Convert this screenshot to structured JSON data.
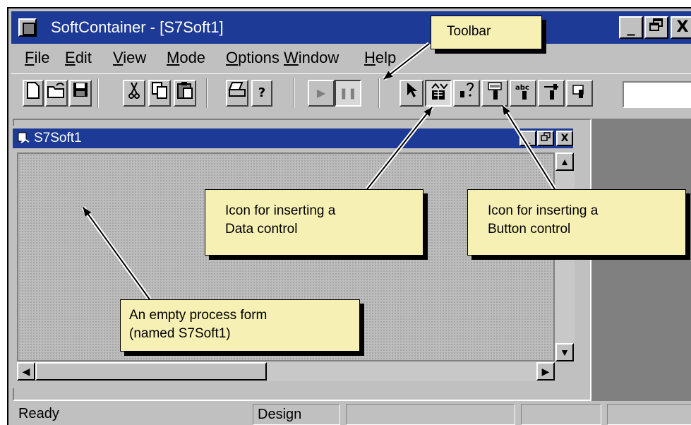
{
  "window": {
    "title": "SoftContainer - [S7Soft1]",
    "buttons": {
      "minimize": "_",
      "restore": "🗗",
      "close": "X"
    }
  },
  "menu": [
    "File",
    "Edit",
    "View",
    "Mode",
    "Options",
    "Window",
    "Help"
  ],
  "toolbar": {
    "icons": [
      "new-file-icon",
      "open-folder-icon",
      "save-disk-icon",
      "cut-icon",
      "copy-icon",
      "paste-icon",
      "print-icon",
      "help-icon",
      "run-icon",
      "pause-icon",
      "pointer-icon",
      "data-control-icon",
      "toggle-control-icon",
      "button-control-icon",
      "text-control-icon",
      "slider-control-icon",
      "misc-control-icon"
    ],
    "help_glyph": "?"
  },
  "child_window": {
    "title": "S7Soft1",
    "buttons": {
      "minimize": "_",
      "restore": "🗗",
      "close": "X"
    }
  },
  "status": {
    "left": "Ready",
    "mode": "Design"
  },
  "callouts": {
    "toolbar": "Toolbar",
    "data_control": [
      "Icon for inserting a",
      "Data control"
    ],
    "button_control": [
      "Icon for inserting a",
      "Button control"
    ],
    "process_form": [
      "An empty process form",
      "(named S7Soft1)"
    ]
  },
  "colors": {
    "titlebar": "#1c3a96",
    "callout_fill": "#f7f0b4",
    "chrome": "#c0c0c0"
  }
}
